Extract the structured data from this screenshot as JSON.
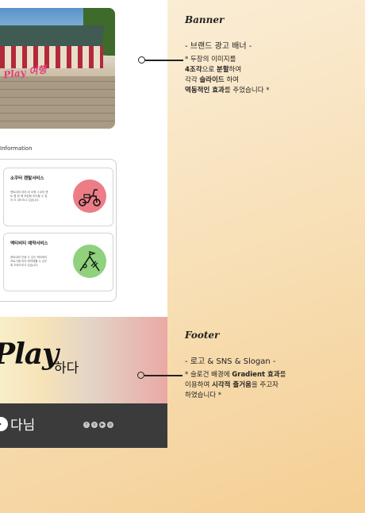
{
  "banner_image": {
    "overlay_text": "Play 여행"
  },
  "information": {
    "title": "Information",
    "cards": [
      {
        "title": "소쿠터 렌탈서비스",
        "desc": "렌트대여 여러 대 소형 스쿠터 렌트 합 한 예 조립체 미도할 수 업지 도 내드리고 있습니다.",
        "color": "#ec7d86",
        "icon": "scooter-icon"
      },
      {
        "title": "액티비티 예약서비스",
        "desc": "렌트대여 관광 수 있는 액티비티 프로그램 미리 예약체를 수 있도록 도와드리고 있습니다.",
        "color": "#8fd17c",
        "icon": "activity-icon"
      }
    ]
  },
  "footer_preview": {
    "play_text": "Play",
    "hada_text": "하다",
    "logo_text": "다님",
    "sns": [
      "f",
      "x",
      "▶",
      "◎"
    ]
  },
  "annotations": {
    "banner": {
      "label": "Banner",
      "subtitle": "- 브랜드 광고 배너 -",
      "line1_pre": "* 두장의 이미지를",
      "line2_bold": "4조각",
      "line2_mid": "으로 ",
      "line2_bold2": "분할",
      "line2_post": "하여",
      "line3_pre": "각각 ",
      "line3_bold": "슬라이드",
      "line3_post": " 하여",
      "line4_bold": "역동적인 효과",
      "line4_post": "를 주었습니다 *"
    },
    "footer": {
      "label": "Footer",
      "subtitle": "- 로고 & SNS & Slogan -",
      "line1_pre": "* 슬로건 배경에 ",
      "line1_bold": "Gradient 효과",
      "line1_post": "를",
      "line2_pre": "이용하여 ",
      "line2_bold": "시각적 즐거움",
      "line2_post": "을 주고자",
      "line3": "하였습니다 *"
    }
  }
}
